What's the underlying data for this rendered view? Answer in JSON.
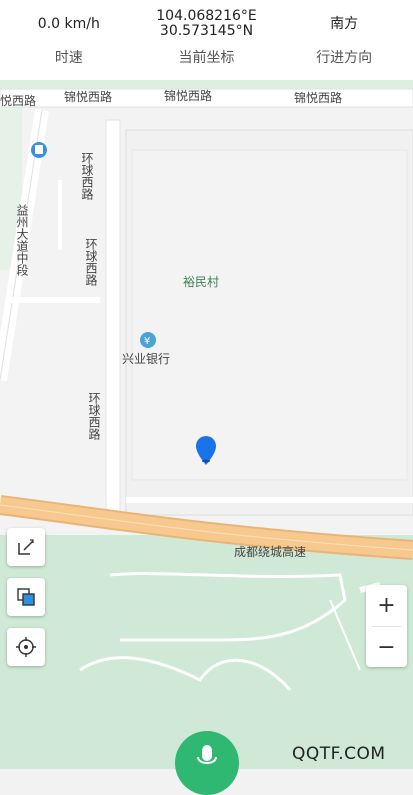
{
  "header": {
    "speed": {
      "value": "0.0 km/h",
      "label": "时速"
    },
    "coords": {
      "lon": "104.068216°E",
      "lat": "30.573145°N",
      "label": "当前坐标"
    },
    "direction": {
      "value": "南方",
      "label": "行进方向"
    }
  },
  "map": {
    "labels": {
      "road_top_left": "悦西路",
      "road_top_1": "锦悦西路",
      "road_top_2": "锦悦西路",
      "road_top_3": "锦悦西路",
      "huanqiu_1": "环球西路",
      "huanqiu_2": "环球西路",
      "huanqiu_3": "环球西路",
      "yizhou": "益州大道中段",
      "village": "裕民村",
      "bank": "兴业银行",
      "bank_icon": "¥",
      "highway": "成都绕城高速"
    },
    "colors": {
      "marker": "#1a73e8",
      "green": "#cfe9d6",
      "highway": "#f1b36a"
    }
  },
  "controls": {
    "zoom_in": "+",
    "zoom_out": "−",
    "edit_icon": "edit-icon",
    "layers_icon": "layers-icon",
    "locate_icon": "locate-icon"
  },
  "watermark": "QQTF.COM"
}
